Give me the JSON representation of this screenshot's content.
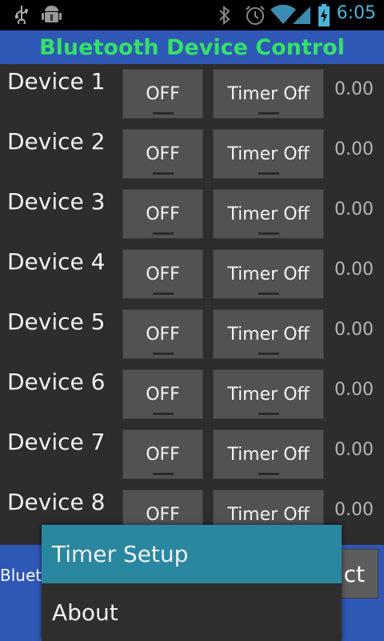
{
  "status_bar": {
    "time": "6:05",
    "icons": [
      "usb-icon",
      "android-debug-icon",
      "bluetooth-icon",
      "alarm-icon",
      "wifi-icon",
      "signal-icon",
      "battery-charging-icon"
    ]
  },
  "app": {
    "title": "Bluetooth Device Control"
  },
  "devices": [
    {
      "label": "Device 1",
      "toggle": "OFF",
      "timer": "Timer Off",
      "value": "0.00"
    },
    {
      "label": "Device 2",
      "toggle": "OFF",
      "timer": "Timer Off",
      "value": "0.00"
    },
    {
      "label": "Device 3",
      "toggle": "OFF",
      "timer": "Timer Off",
      "value": "0.00"
    },
    {
      "label": "Device 4",
      "toggle": "OFF",
      "timer": "Timer Off",
      "value": "0.00"
    },
    {
      "label": "Device 5",
      "toggle": "OFF",
      "timer": "Timer Off",
      "value": "0.00"
    },
    {
      "label": "Device 6",
      "toggle": "OFF",
      "timer": "Timer Off",
      "value": "0.00"
    },
    {
      "label": "Device 7",
      "toggle": "OFF",
      "timer": "Timer Off",
      "value": "0.00"
    },
    {
      "label": "Device 8",
      "toggle": "OFF",
      "timer": "Timer Off",
      "value": "0.00"
    }
  ],
  "bottom_bar": {
    "left_text": "Bluet",
    "connect_label": "ct"
  },
  "menu": {
    "items": [
      "Timer Setup",
      "About"
    ]
  },
  "colors": {
    "title_bar": "#2f57b5",
    "title_text": "#35e06a",
    "menu_selected": "#2a87a0",
    "status_time": "#4fb3d9"
  }
}
